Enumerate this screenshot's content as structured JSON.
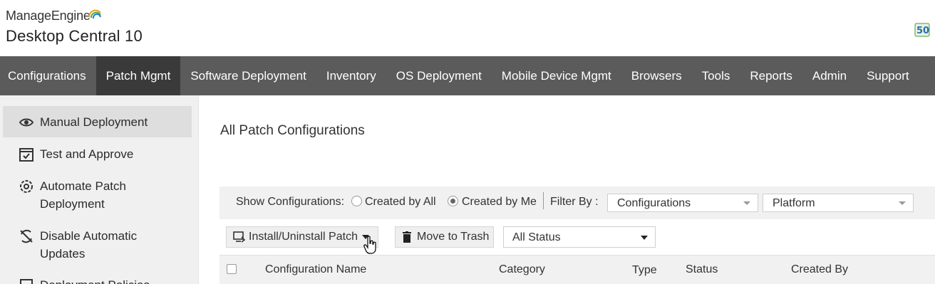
{
  "brand": {
    "company": "ManageEngine",
    "product": "Desktop Central 10"
  },
  "nav": {
    "items": [
      {
        "label": "Configurations"
      },
      {
        "label": "Patch Mgmt",
        "active": true
      },
      {
        "label": "Software Deployment"
      },
      {
        "label": "Inventory"
      },
      {
        "label": "OS Deployment"
      },
      {
        "label": "Mobile Device Mgmt"
      },
      {
        "label": "Browsers"
      },
      {
        "label": "Tools"
      },
      {
        "label": "Reports"
      },
      {
        "label": "Admin"
      },
      {
        "label": "Support"
      }
    ]
  },
  "sidebar": {
    "items": [
      {
        "label": "Manual Deployment",
        "icon": "eye-icon",
        "active": true
      },
      {
        "label": "Test and Approve",
        "icon": "calendar-check-icon"
      },
      {
        "label": "Automate Patch Deployment",
        "icon": "gear-cycle-icon"
      },
      {
        "label": "Disable Automatic Updates",
        "icon": "sync-disabled-icon"
      },
      {
        "label": "Deployment Policies",
        "icon": "policy-icon"
      }
    ]
  },
  "main": {
    "title": "All Patch Configurations"
  },
  "filters": {
    "show_label": "Show Configurations:",
    "radio_all": "Created by All",
    "radio_me": "Created by Me",
    "selected": "Created by Me",
    "filter_by_label": "Filter By :",
    "configurations_select": "Configurations",
    "platform_select": "Platform"
  },
  "actions": {
    "install_label": "Install/Uninstall Patch",
    "trash_label": "Move to Trash",
    "status_select": "All Status"
  },
  "table": {
    "columns": [
      "Configuration Name",
      "Category",
      "Type",
      "Status",
      "Created By"
    ]
  },
  "colors": {
    "navbar": "#5b5b5b",
    "navbar_active": "#3a3a3a",
    "sidebar_bg": "#f0f0f0",
    "sidebar_active": "#dedede"
  }
}
